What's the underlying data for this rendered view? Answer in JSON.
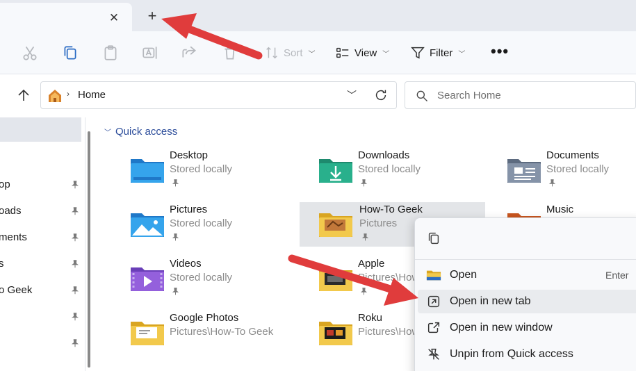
{
  "tabs": {
    "close_glyph": "✕",
    "new_tab_glyph": "+"
  },
  "toolbar": {
    "sort_label": "Sort",
    "view_label": "View",
    "filter_label": "Filter",
    "more_glyph": "•••"
  },
  "address": {
    "path": "Home",
    "separator": "›"
  },
  "search": {
    "placeholder": "Search Home"
  },
  "nav": {
    "items": [
      {
        "label": "op"
      },
      {
        "label": "oads"
      },
      {
        "label": "ments"
      },
      {
        "label": "s"
      },
      {
        "label": "o Geek"
      },
      {
        "label": ""
      },
      {
        "label": ""
      }
    ]
  },
  "quick_access": {
    "header": "Quick access",
    "items": [
      {
        "name": "Desktop",
        "sub": "Stored locally",
        "icon": "desktop-folder-icon"
      },
      {
        "name": "Downloads",
        "sub": "Stored locally",
        "icon": "downloads-folder-icon"
      },
      {
        "name": "Documents",
        "sub": "Stored locally",
        "icon": "documents-folder-icon"
      },
      {
        "name": "Pictures",
        "sub": "Stored locally",
        "icon": "pictures-folder-icon"
      },
      {
        "name": "How-To Geek",
        "sub": "Pictures",
        "icon": "folder-icon"
      },
      {
        "name": "Music",
        "sub": "",
        "icon": "music-folder-icon"
      },
      {
        "name": "Videos",
        "sub": "Stored locally",
        "icon": "videos-folder-icon"
      },
      {
        "name": "Apple",
        "sub": "Pictures\\How-To Geek",
        "icon": "folder-icon"
      },
      {
        "name": "Google Photos",
        "sub": "Pictures\\How-To Geek",
        "icon": "folder-icon"
      },
      {
        "name": "Roku",
        "sub": "Pictures\\How-To Geek",
        "icon": "folder-icon"
      }
    ]
  },
  "context_menu": {
    "items": [
      {
        "label": "Open",
        "shortcut": "Enter",
        "icon": "folder-icon"
      },
      {
        "label": "Open in new tab",
        "shortcut": "",
        "icon": "open-new-tab-icon"
      },
      {
        "label": "Open in new window",
        "shortcut": "",
        "icon": "open-new-window-icon"
      },
      {
        "label": "Unpin from Quick access",
        "shortcut": "",
        "icon": "unpin-icon"
      }
    ]
  },
  "colors": {
    "annotation_arrow": "#e03c3c",
    "accent": "#2b4c9a",
    "folder_yellow": "#f2c94c"
  }
}
